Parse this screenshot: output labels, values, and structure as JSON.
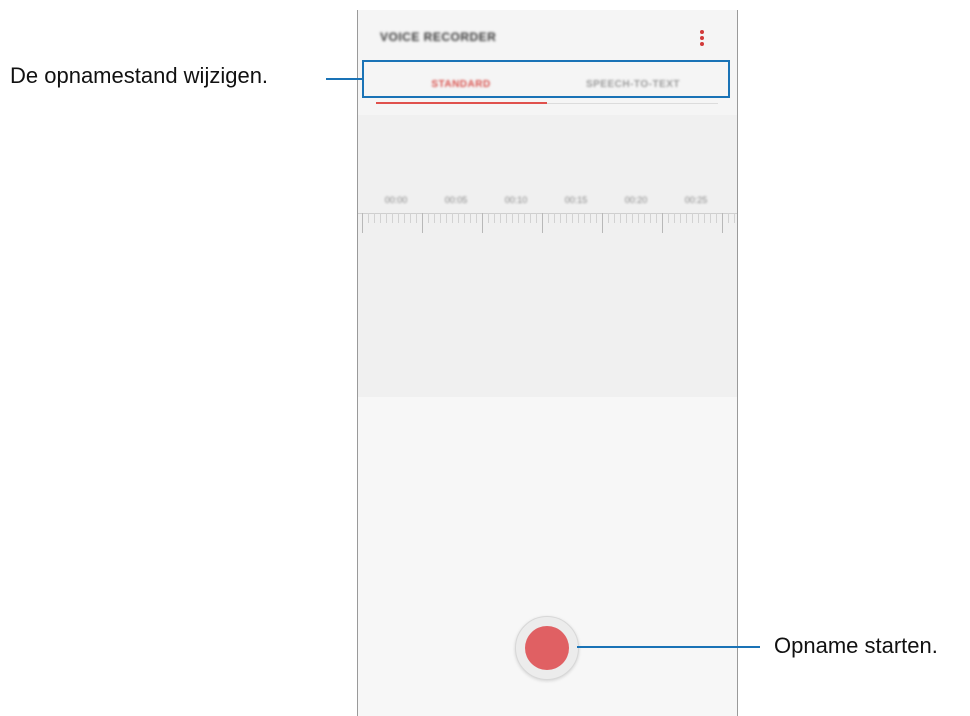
{
  "app": {
    "title": "VOICE RECORDER",
    "menu_icon": "more-vertical-icon",
    "accent_color": "#e0514d"
  },
  "tabs": [
    {
      "label": "STANDARD",
      "selected": true
    },
    {
      "label": "SPEECH-TO-TEXT",
      "selected": false
    }
  ],
  "timeline": {
    "labels": [
      "00:00",
      "00:05",
      "00:10",
      "00:15",
      "00:20",
      "00:25"
    ]
  },
  "record": {
    "icon": "record-icon",
    "color": "#e06063"
  },
  "callouts": {
    "mode": "De opnamestand wijzigen.",
    "record": "Opname starten.",
    "color": "#1a73b6"
  }
}
